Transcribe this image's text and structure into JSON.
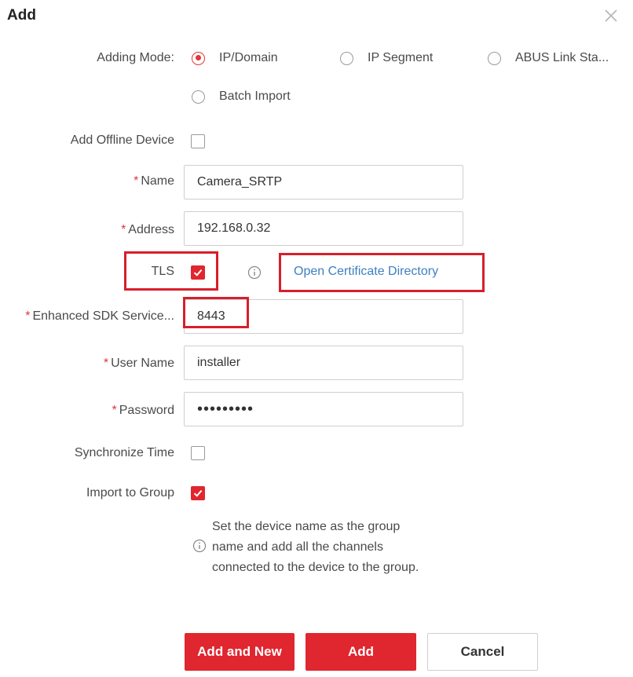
{
  "dialog": {
    "title": "Add"
  },
  "adding_mode": {
    "label": "Adding Mode:",
    "options": [
      {
        "label": "IP/Domain",
        "selected": true
      },
      {
        "label": "IP Segment",
        "selected": false
      },
      {
        "label": "ABUS Link Sta...",
        "selected": false
      },
      {
        "label": "Batch Import",
        "selected": false
      }
    ]
  },
  "add_offline_device": {
    "label": "Add Offline Device",
    "checked": false
  },
  "name": {
    "label": "Name",
    "required": "*",
    "value": "Camera_SRTP"
  },
  "address": {
    "label": "Address",
    "required": "*",
    "value": "192.168.0.32"
  },
  "tls": {
    "label": "TLS",
    "checked": true,
    "link": "Open Certificate Directory"
  },
  "sdk_port": {
    "label": "Enhanced SDK Service...",
    "required": "*",
    "value": "8443"
  },
  "user_name": {
    "label": "User Name",
    "required": "*",
    "value": "installer"
  },
  "password": {
    "label": "Password",
    "required": "*",
    "value": "•••••••••"
  },
  "sync_time": {
    "label": "Synchronize Time",
    "checked": false
  },
  "import_group": {
    "label": "Import to Group",
    "checked": true,
    "hint_lines": [
      "Set the device name as the group",
      "name and add all the channels",
      "connected to the device to the group."
    ]
  },
  "buttons": {
    "add_and_new": "Add and New",
    "add": "Add",
    "cancel": "Cancel"
  },
  "colors": {
    "accent": "#e0262e",
    "highlight_box": "#d71f2a",
    "link": "#3d7fc1"
  }
}
